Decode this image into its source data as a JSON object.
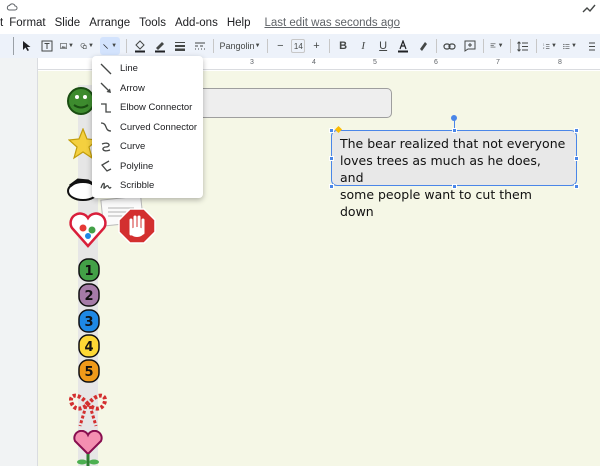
{
  "menu": {
    "items": [
      "t",
      "Format",
      "Slide",
      "Arrange",
      "Tools",
      "Add-ons",
      "Help"
    ],
    "last_edit": "Last edit was seconds ago"
  },
  "toolbar": {
    "font": "Pangolin",
    "font_size": "14",
    "minus": "−",
    "plus": "+"
  },
  "ruler": {
    "labels": [
      "3",
      "4",
      "5",
      "6",
      "7",
      "8"
    ]
  },
  "line_menu": {
    "items": [
      "Line",
      "Arrow",
      "Elbow Connector",
      "Curved Connector",
      "Curve",
      "Polyline",
      "Scribble"
    ]
  },
  "slide": {
    "text_lines": [
      "The bear realized that not everyone",
      "loves trees as much as he does, and",
      "some people want to cut them down"
    ],
    "number_badges": [
      "1",
      "2",
      "3",
      "4",
      "5"
    ]
  },
  "colors": {
    "accent": "#4a86e8",
    "slide_bg": "#f5f7e6",
    "toolbar_bg": "#edf2fa"
  }
}
